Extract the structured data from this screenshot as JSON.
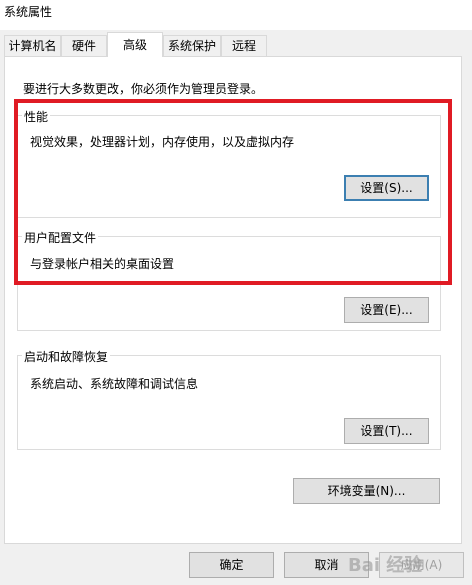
{
  "window": {
    "title": "系统属性"
  },
  "tabs": [
    {
      "label": "计算机名"
    },
    {
      "label": "硬件"
    },
    {
      "label": "高级"
    },
    {
      "label": "系统保护"
    },
    {
      "label": "远程"
    }
  ],
  "admin_note": "要进行大多数更改，你必须作为管理员登录。",
  "performance": {
    "title": "性能",
    "description": "视觉效果，处理器计划，内存使用，以及虚拟内存",
    "settings_label": "设置(S)..."
  },
  "user_profiles": {
    "title": "用户配置文件",
    "description": "与登录帐户相关的桌面设置",
    "settings_label": "设置(E)..."
  },
  "startup_recovery": {
    "title": "启动和故障恢复",
    "description": "系统启动、系统故障和调试信息",
    "settings_label": "设置(T)..."
  },
  "env_vars_label": "环境变量(N)...",
  "footer": {
    "ok_label": "确定",
    "cancel_label": "取消",
    "apply_label": "应用(A)"
  },
  "watermark": "Bai 经验",
  "colors": {
    "highlight": "#e01b24",
    "focus": "#3c7fb1"
  }
}
